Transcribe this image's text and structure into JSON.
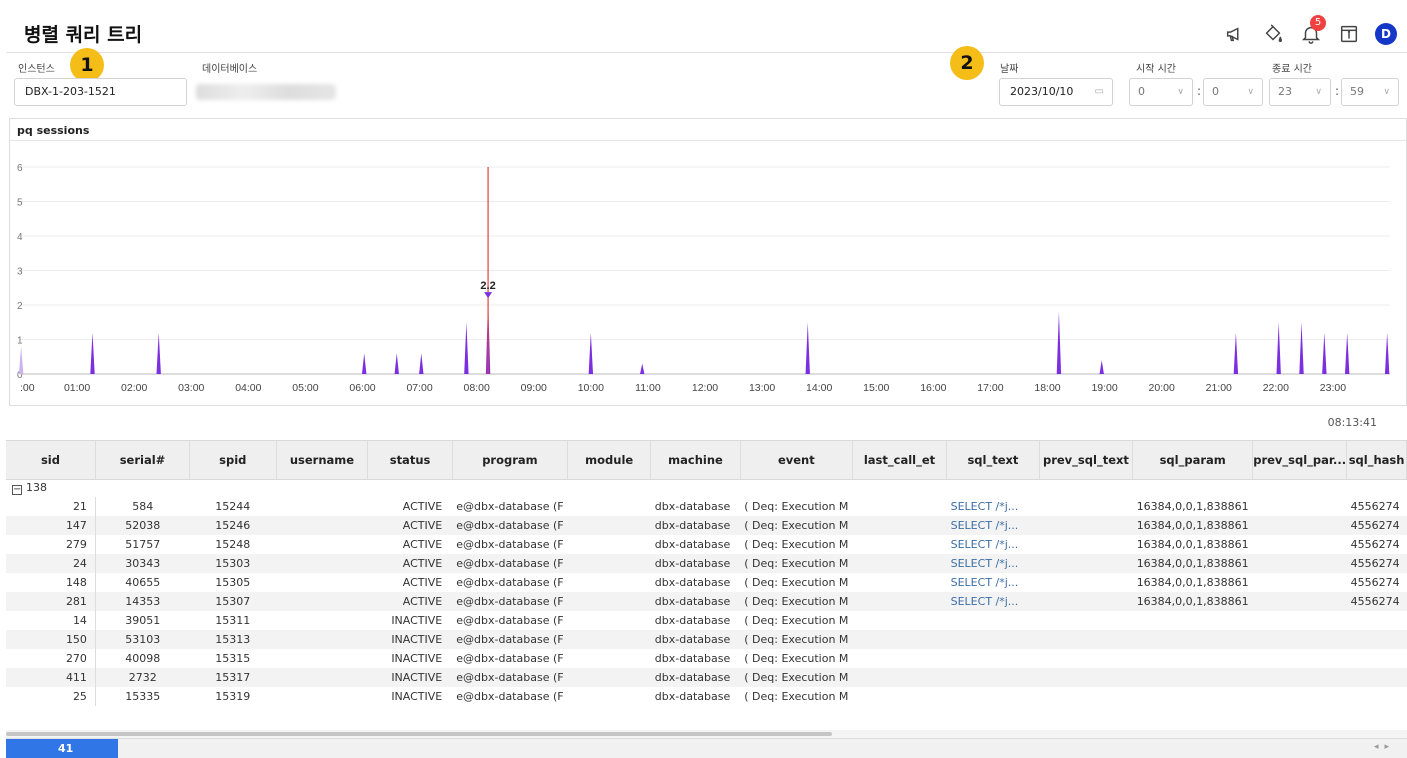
{
  "page": {
    "title": "병렬 쿼리 트리"
  },
  "header_icons": [
    "megaphone-icon",
    "paint-bucket-icon",
    "bell-icon",
    "calendar-info-icon"
  ],
  "notifications": {
    "count": "5"
  },
  "user": {
    "avatar_letter": "D",
    "avatar_color": "#1537c8"
  },
  "filters": {
    "instance_label": "인스턴스",
    "instance_value": "DBX-1-203-1521",
    "database_label": "데이터베이스",
    "step1": "1",
    "step2": "2",
    "date_label": "날짜",
    "date_value": "2023/10/10",
    "start_label": "시작 시간",
    "start_hour": "0",
    "start_min": "0",
    "end_label": "종료 시간",
    "end_hour": "23",
    "end_min": "59",
    "colon": ":"
  },
  "chart": {
    "title": "pq sessions",
    "accent": "#7b2fe0",
    "marker_color": "#e04040",
    "marker_label": "2.2"
  },
  "chart_data": {
    "type": "bar",
    "title": "pq sessions",
    "ylim": [
      0,
      6
    ],
    "yticks": [
      "0",
      "1",
      "2",
      "3",
      "4",
      "5",
      "6"
    ],
    "xticks": [
      ":00",
      "01:00",
      "02:00",
      "03:00",
      "04:00",
      "05:00",
      "06:00",
      "07:00",
      "08:00",
      "09:00",
      "10:00",
      "11:00",
      "12:00",
      "13:00",
      "14:00",
      "15:00",
      "16:00",
      "17:00",
      "18:00",
      "19:00",
      "20:00",
      "21:00",
      "22:00",
      "23:00"
    ],
    "x_unit": "hour",
    "series": [
      {
        "x": [
          0.02,
          1.27,
          2.43,
          6.03,
          6.6,
          7.03,
          7.82,
          8.2,
          10.0,
          10.9,
          13.8,
          18.2,
          18.95,
          21.3,
          22.05,
          22.45,
          22.85,
          23.25,
          24.0
        ],
        "values": [
          0.8,
          1.2,
          1.2,
          0.6,
          0.6,
          0.6,
          1.5,
          2.2,
          1.2,
          0.3,
          1.5,
          1.8,
          0.4,
          1.2,
          1.5,
          1.5,
          1.2,
          1.2,
          1.2
        ]
      }
    ],
    "marker": {
      "x": 8.2,
      "y_top": 6,
      "value_label": "2.2"
    }
  },
  "timestamp": "08:13:41",
  "table": {
    "columns": [
      "sid",
      "serial#",
      "spid",
      "username",
      "status",
      "program",
      "module",
      "machine",
      "event",
      "last_call_et",
      "sql_text",
      "prev_sql_text",
      "sql_param",
      "prev_sql_par...",
      "sql_hash"
    ],
    "group": "138",
    "rows": [
      [
        "21",
        "584",
        "15244",
        "",
        "ACTIVE",
        "e@dbx-database (F",
        "",
        "dbx-database",
        "( Deq: Execution M",
        "",
        "SELECT /*j...",
        "",
        "16384,0,0,1,838861",
        "",
        "4556274"
      ],
      [
        "147",
        "52038",
        "15246",
        "",
        "ACTIVE",
        "e@dbx-database (F",
        "",
        "dbx-database",
        "( Deq: Execution M",
        "",
        "SELECT /*j...",
        "",
        "16384,0,0,1,838861",
        "",
        "4556274"
      ],
      [
        "279",
        "51757",
        "15248",
        "",
        "ACTIVE",
        "e@dbx-database (F",
        "",
        "dbx-database",
        "( Deq: Execution M",
        "",
        "SELECT /*j...",
        "",
        "16384,0,0,1,838861",
        "",
        "4556274"
      ],
      [
        "24",
        "30343",
        "15303",
        "",
        "ACTIVE",
        "e@dbx-database (F",
        "",
        "dbx-database",
        "( Deq: Execution M",
        "",
        "SELECT /*j...",
        "",
        "16384,0,0,1,838861",
        "",
        "4556274"
      ],
      [
        "148",
        "40655",
        "15305",
        "",
        "ACTIVE",
        "e@dbx-database (F",
        "",
        "dbx-database",
        "( Deq: Execution M",
        "",
        "SELECT /*j...",
        "",
        "16384,0,0,1,838861",
        "",
        "4556274"
      ],
      [
        "281",
        "14353",
        "15307",
        "",
        "ACTIVE",
        "e@dbx-database (F",
        "",
        "dbx-database",
        "( Deq: Execution M",
        "",
        "SELECT /*j...",
        "",
        "16384,0,0,1,838861",
        "",
        "4556274"
      ],
      [
        "14",
        "39051",
        "15311",
        "",
        "INACTIVE",
        "e@dbx-database (F",
        "",
        "dbx-database",
        "( Deq: Execution M",
        "",
        "",
        "",
        "",
        "",
        ""
      ],
      [
        "150",
        "53103",
        "15313",
        "",
        "INACTIVE",
        "e@dbx-database (F",
        "",
        "dbx-database",
        "( Deq: Execution M",
        "",
        "",
        "",
        "",
        "",
        ""
      ],
      [
        "270",
        "40098",
        "15315",
        "",
        "INACTIVE",
        "e@dbx-database (F",
        "",
        "dbx-database",
        "( Deq: Execution M",
        "",
        "",
        "",
        "",
        "",
        ""
      ],
      [
        "411",
        "2732",
        "15317",
        "",
        "INACTIVE",
        "e@dbx-database (F",
        "",
        "dbx-database",
        "( Deq: Execution M",
        "",
        "",
        "",
        "",
        "",
        ""
      ],
      [
        "25",
        "15335",
        "15319",
        "",
        "INACTIVE",
        "e@dbx-database (F",
        "",
        "dbx-database",
        "( Deq: Execution M",
        "",
        "",
        "",
        "",
        "",
        ""
      ]
    ]
  },
  "footer": {
    "count": "41"
  }
}
